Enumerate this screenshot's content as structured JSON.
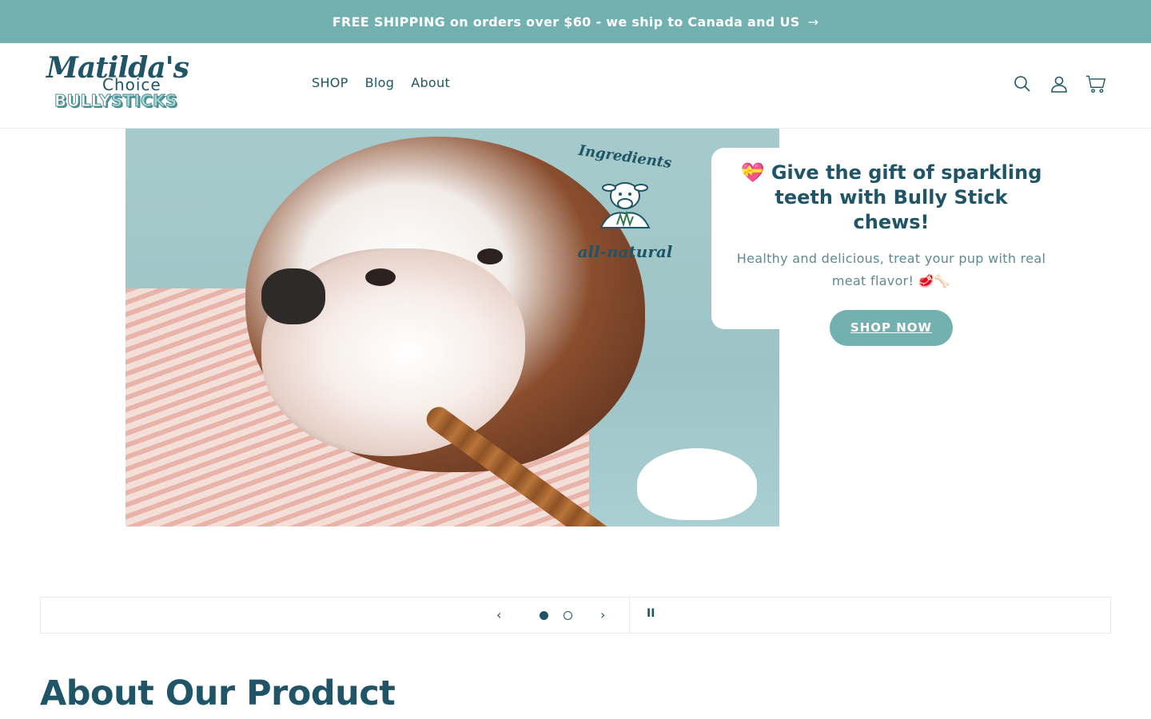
{
  "announcement": {
    "text": "FREE SHIPPING on orders over $60 - we ship to Canada and US",
    "arrow": "→"
  },
  "logo": {
    "line1": "Matilda's",
    "line2": "Choice",
    "line3a": "BULLY",
    "line3b": "STICKS"
  },
  "nav": {
    "items": [
      "SHOP",
      "Blog",
      "About"
    ]
  },
  "header_icons": [
    "search-icon",
    "account-icon",
    "cart-icon"
  ],
  "hero": {
    "badge_top": "Ingredients",
    "badge_bottom": "all-natural",
    "heading": "💝 Give the gift of sparkling teeth with Bully Stick chews!",
    "subtext": "Healthy and delicious, treat your pup with real meat flavor! 🥩🦴",
    "cta": "SHOP NOW"
  },
  "slider": {
    "prev": "‹",
    "next": "›",
    "pause": "II",
    "slides": 2,
    "active": 1
  },
  "section": {
    "title": "About Our Product"
  },
  "colors": {
    "teal": "#72b1b0",
    "navy": "#1f5566"
  }
}
